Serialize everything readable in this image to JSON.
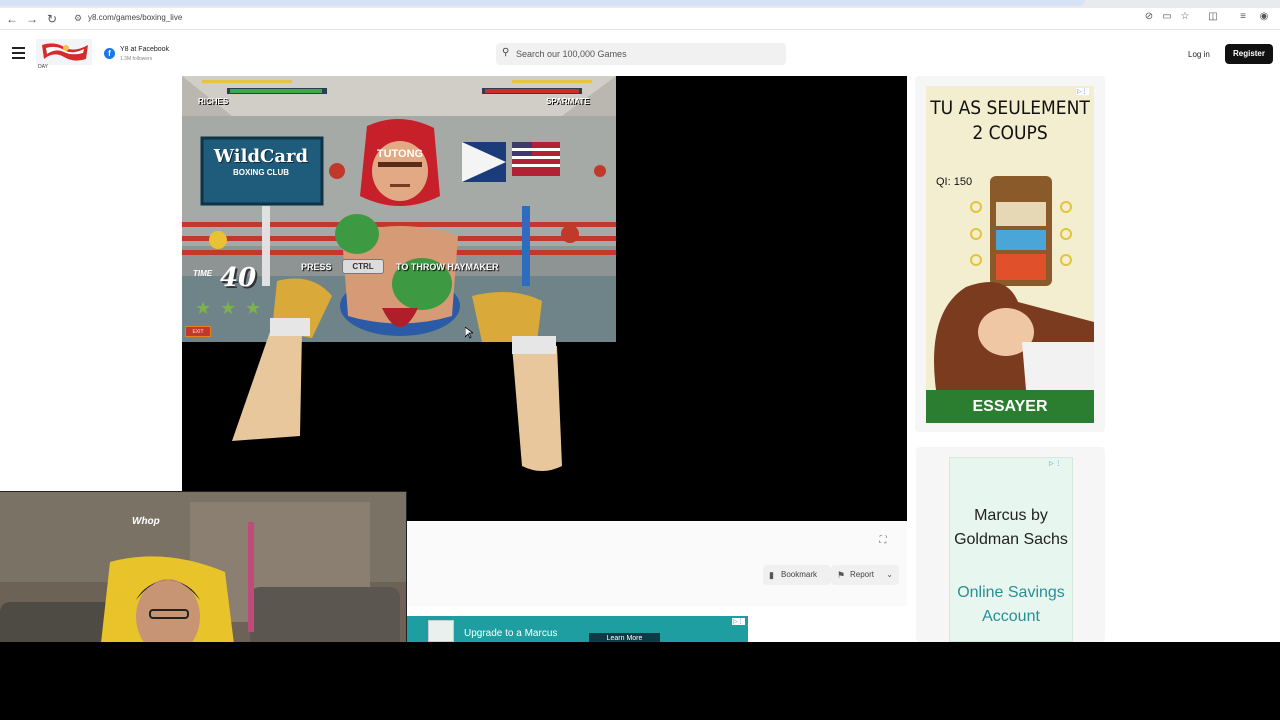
{
  "browser": {
    "url": "y8.com/games/boxing_live",
    "nav": {
      "back": "←",
      "forward": "→",
      "reload": "↻"
    }
  },
  "header": {
    "logo_text": "DAY",
    "facebook": {
      "icon": "f",
      "title": "Y8 at Facebook",
      "followers": "1.3M followers"
    },
    "search": {
      "placeholder": "Search our 100,000 Games"
    },
    "login_label": "Log in",
    "register_label": "Register"
  },
  "game": {
    "player_left": "RICHES",
    "player_right": "SPARMATE",
    "gym_sign_line1": "WildCard",
    "gym_sign_line2": "BOXING CLUB",
    "opponent_headgear": "TUTONG",
    "tutorial_press": "PRESS",
    "tutorial_key": "CTRL",
    "tutorial_action": "TO THROW HAYMAKER",
    "time_label": "TIME",
    "time_value": "40",
    "stars": 3,
    "exit_label": "EXIT"
  },
  "toolbar": {
    "bookmark_label": "Bookmark",
    "report_label": "Report"
  },
  "bottom_ad": {
    "title": "Upgrade to a Marcus",
    "cta": "Learn More"
  },
  "right_ad_1": {
    "headline_line1": "TU AS SEULEMENT",
    "headline_line2": "2 COUPS",
    "score": "QI: 150",
    "cta": "ESSAYER"
  },
  "right_ad_2": {
    "title": "Marcus by Goldman Sachs",
    "link": "Online Savings Account"
  },
  "webcam": {
    "sign_text": "Whop"
  },
  "colors": {
    "accent_dark": "#111111",
    "facebook_blue": "#1877f2",
    "marcus_teal": "#1e9ea0",
    "essayer_green": "#2b7d2f"
  }
}
